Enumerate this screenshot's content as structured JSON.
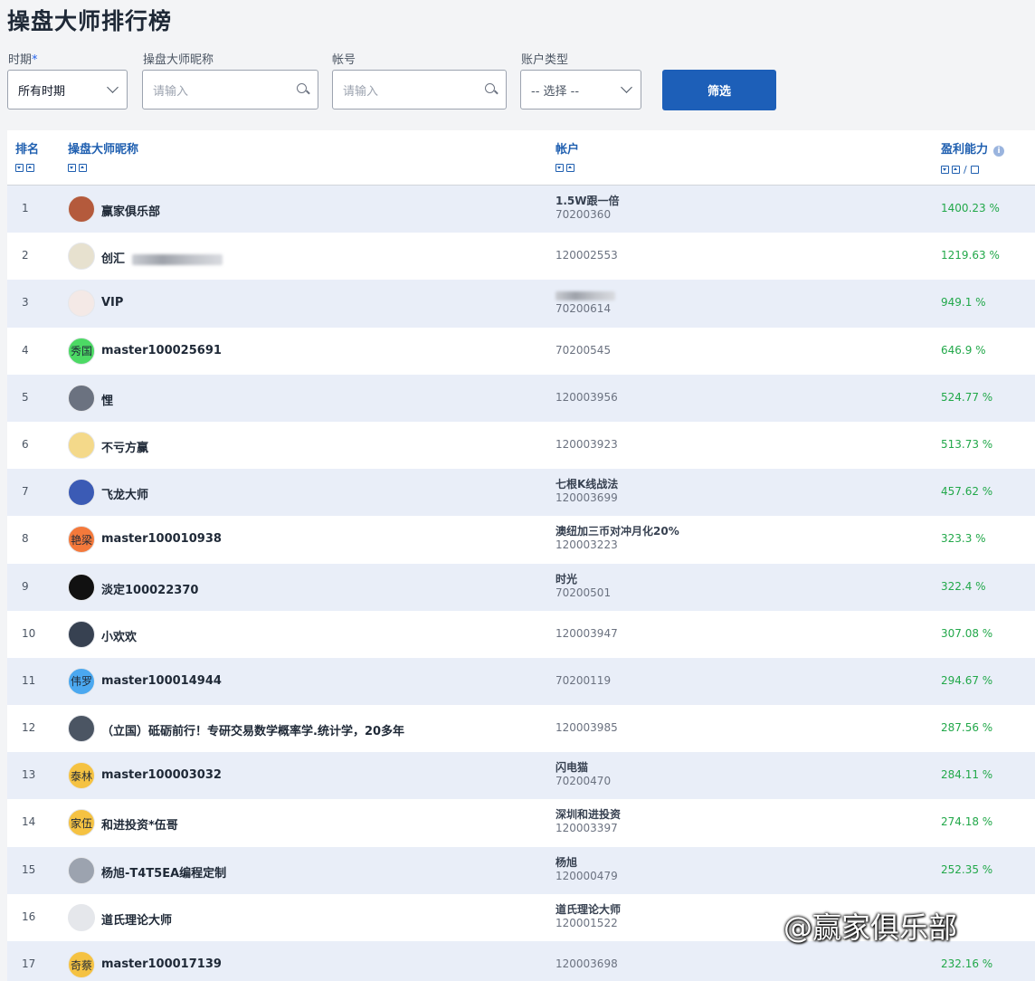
{
  "page": {
    "title": "操盘大师排行榜"
  },
  "filters": {
    "period": {
      "label": "时期",
      "required_mark": "*",
      "value": "所有时期"
    },
    "nickname": {
      "label": "操盘大师昵称",
      "placeholder": "请输入"
    },
    "account": {
      "label": "帐号",
      "placeholder": "请输入"
    },
    "account_type": {
      "label": "账户类型",
      "value": "-- 选择 --"
    },
    "submit_label": "筛选"
  },
  "table": {
    "columns": {
      "rank": "排名",
      "name": "操盘大师昵称",
      "account": "帐户",
      "profit": "盈利能力"
    },
    "profit_sort_separator": "/",
    "rows": [
      {
        "rank": "1",
        "name": "赢家俱乐部",
        "avatar_text": "",
        "avatar_color": "#b45a3c",
        "account_alias": "1.5W跟一倍",
        "account_number": "70200360",
        "profit": "1400.23 %"
      },
      {
        "rank": "2",
        "name": "创汇",
        "avatar_text": "",
        "avatar_color": "#e7e1cf",
        "account_alias": "",
        "account_number": "120002553",
        "profit": "1219.63 %"
      },
      {
        "rank": "3",
        "name": "VIP",
        "avatar_text": "",
        "avatar_color": "#f4e9e6",
        "account_alias": "",
        "account_number": "70200614",
        "profit": "949.1 %"
      },
      {
        "rank": "4",
        "name": "master100025691",
        "avatar_text": "秀国",
        "avatar_color": "#4cd964",
        "account_alias": "",
        "account_number": "70200545",
        "profit": "646.9 %"
      },
      {
        "rank": "5",
        "name": "悝",
        "avatar_text": "",
        "avatar_color": "#6b7280",
        "account_alias": "",
        "account_number": "120003956",
        "profit": "524.77 %"
      },
      {
        "rank": "6",
        "name": "不亏方赢",
        "avatar_text": "",
        "avatar_color": "#f4d98a",
        "account_alias": "",
        "account_number": "120003923",
        "profit": "513.73 %"
      },
      {
        "rank": "7",
        "name": "飞龙大师",
        "avatar_text": "",
        "avatar_color": "#3b5bb5",
        "account_alias": "七根K线战法",
        "account_number": "120003699",
        "profit": "457.62 %"
      },
      {
        "rank": "8",
        "name": "master100010938",
        "avatar_text": "艳梁",
        "avatar_color": "#f4793b",
        "account_alias": "澳纽加三币对冲月化20%",
        "account_number": "120003223",
        "profit": "323.3 %"
      },
      {
        "rank": "9",
        "name": "淡定100022370",
        "avatar_text": "",
        "avatar_color": "#111111",
        "account_alias": "时光",
        "account_number": "70200501",
        "profit": "322.4 %"
      },
      {
        "rank": "10",
        "name": "小欢欢",
        "avatar_text": "",
        "avatar_color": "#374151",
        "account_alias": "",
        "account_number": "120003947",
        "profit": "307.08 %"
      },
      {
        "rank": "11",
        "name": "master100014944",
        "avatar_text": "伟罗",
        "avatar_color": "#4ba8f0",
        "account_alias": "",
        "account_number": "70200119",
        "profit": "294.67 %"
      },
      {
        "rank": "12",
        "name": "（立国）砥砺前行！专研交易数学概率学.统计学，20多年",
        "avatar_text": "",
        "avatar_color": "#4b5563",
        "account_alias": "",
        "account_number": "120003985",
        "profit": "287.56 %"
      },
      {
        "rank": "13",
        "name": "master100003032",
        "avatar_text": "泰林",
        "avatar_color": "#f5c242",
        "account_alias": "闪电猫",
        "account_number": "70200470",
        "profit": "284.11 %"
      },
      {
        "rank": "14",
        "name": "和进投资*伍哥",
        "avatar_text": "家伍",
        "avatar_color": "#f5c242",
        "account_alias": "深圳和进投资",
        "account_number": "120003397",
        "profit": "274.18 %"
      },
      {
        "rank": "15",
        "name": "杨旭-T4T5EA编程定制",
        "avatar_text": "",
        "avatar_color": "#9ca3af",
        "account_alias": "杨旭",
        "account_number": "120000479",
        "profit": "252.35 %"
      },
      {
        "rank": "16",
        "name": "道氏理论大师",
        "avatar_text": "",
        "avatar_color": "#e5e7eb",
        "account_alias": "道氏理论大师",
        "account_number": "120001522",
        "profit": ""
      },
      {
        "rank": "17",
        "name": "master100017139",
        "avatar_text": "奇蔡",
        "avatar_color": "#f5c242",
        "account_alias": "",
        "account_number": "120003698",
        "profit": "232.16 %"
      }
    ]
  },
  "watermark": "@赢家俱乐部",
  "colors": {
    "accent": "#1d5fb8",
    "profit": "#22a84a",
    "header_text": "#1f5fb0",
    "alt_row": "#e9eef8"
  }
}
